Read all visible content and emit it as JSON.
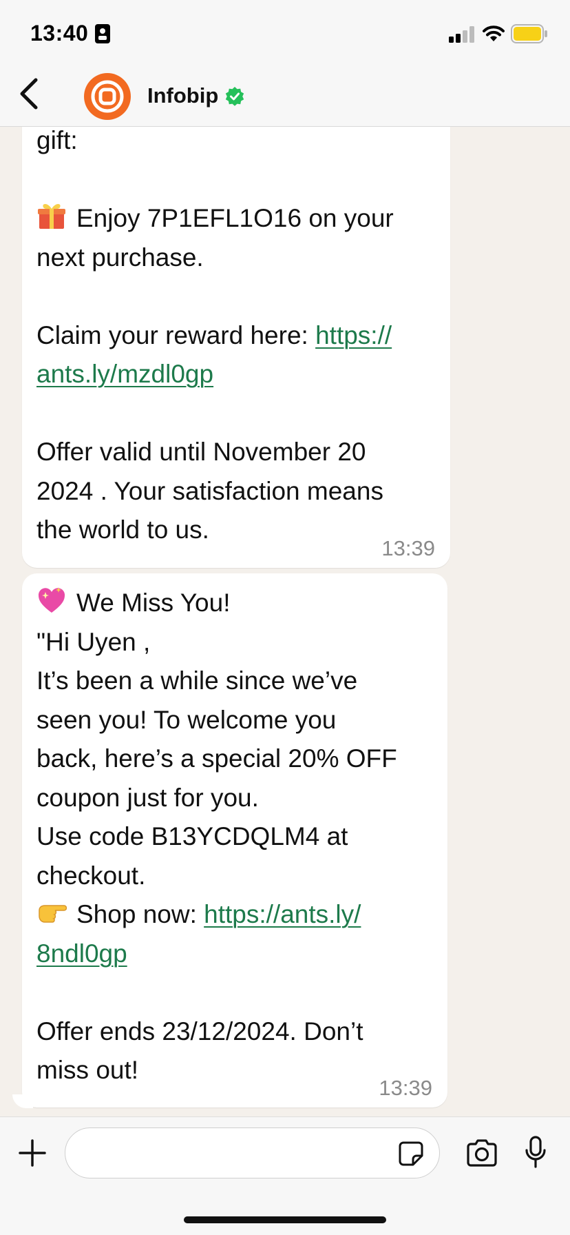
{
  "status_bar": {
    "time": "13:40"
  },
  "header": {
    "contact_name": "Infobip"
  },
  "messages": [
    {
      "lines": [
        {
          "text": "gift:"
        },
        {
          "blank": true
        },
        {
          "emoji": "gift",
          "text": "Enjoy 7P1EFL1O16  on your"
        },
        {
          "text": "next purchase."
        },
        {
          "blank": true
        },
        {
          "text": "Claim your reward here: ",
          "link": "https://"
        },
        {
          "link": "ants.ly/mzdl0gp"
        },
        {
          "blank": true
        },
        {
          "text": "Offer valid until November 20"
        },
        {
          "text": "2024 . Your satisfaction means"
        },
        {
          "text": "the world to us."
        }
      ],
      "time": "13:39"
    },
    {
      "lines": [
        {
          "emoji": "sparkling-heart",
          "text": "We Miss You!"
        },
        {
          "text": "\"Hi Uyen ,"
        },
        {
          "text": "It’s been a while since we’ve"
        },
        {
          "text": "seen you! To welcome you"
        },
        {
          "text": "back, here’s a special 20% OFF"
        },
        {
          "text": "coupon just for you."
        },
        {
          "text": "Use code B13YCDQLM4  at"
        },
        {
          "text": "checkout."
        },
        {
          "emoji": "pointing-hand",
          "text": "Shop now: ",
          "link": "https://ants.ly/"
        },
        {
          "link": "8ndl0gp"
        },
        {
          "blank": true
        },
        {
          "text": "Offer ends 23/12/2024. Don’t"
        },
        {
          "text": "miss out!"
        }
      ],
      "time": "13:39"
    }
  ],
  "composer": {
    "placeholder": ""
  },
  "colors": {
    "link": "#1d7a4b",
    "verified": "#25c05a",
    "avatar": "#f26a21",
    "battery": "#f7d117",
    "chat_background": "#f4f0eb"
  }
}
